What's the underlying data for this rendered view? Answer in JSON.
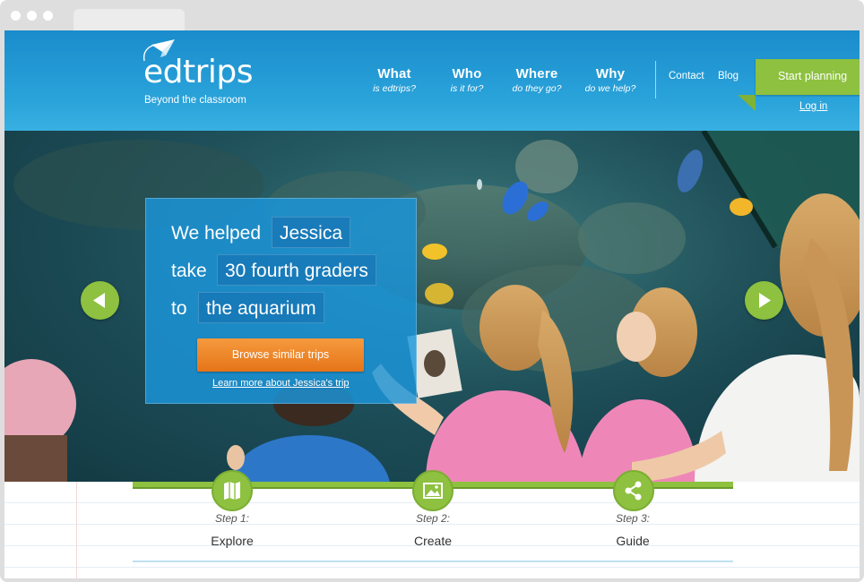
{
  "site": {
    "logo_word": "edtrips",
    "logo_tagline": "Beyond the classroom"
  },
  "nav": {
    "items": [
      {
        "title": "What",
        "subtitle": "is edtrips?"
      },
      {
        "title": "Who",
        "subtitle": "is it for?"
      },
      {
        "title": "Where",
        "subtitle": "do they go?"
      },
      {
        "title": "Why",
        "subtitle": "do we help?"
      }
    ],
    "contact": "Contact",
    "blog": "Blog",
    "start_planning": "Start planning",
    "login": "Log in"
  },
  "hero": {
    "line1_lead": "We helped",
    "line1_value": "Jessica",
    "line2_lead": "take",
    "line2_value": "30 fourth graders",
    "line3_lead": "to",
    "line3_value": "the aquarium",
    "browse_button": "Browse similar trips",
    "learn_more": "Learn more about Jessica's trip",
    "prev_icon": "arrow-left-icon",
    "next_icon": "arrow-right-icon"
  },
  "steps": [
    {
      "number": "Step 1:",
      "name": "Explore",
      "icon": "map-icon"
    },
    {
      "number": "Step 2:",
      "name": "Create",
      "icon": "image-icon"
    },
    {
      "number": "Step 3:",
      "name": "Guide",
      "icon": "share-icon"
    }
  ],
  "colors": {
    "header_blue": "#1a8ccc",
    "accent_green": "#8dc13f",
    "cta_orange": "#f08a2c",
    "promo_blue": "#1b96dc"
  }
}
